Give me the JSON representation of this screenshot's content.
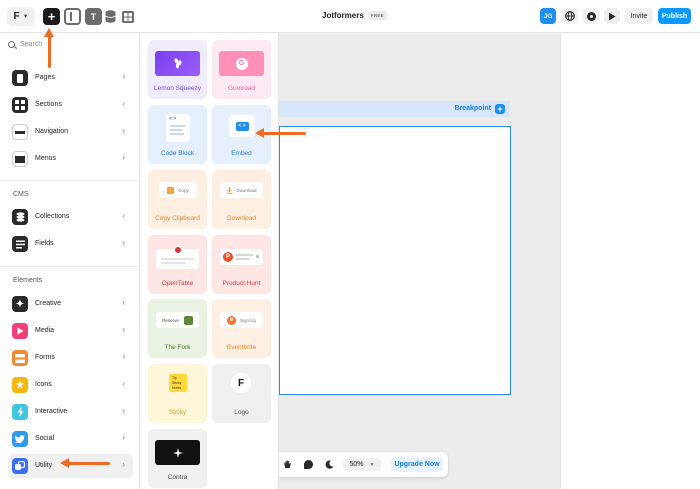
{
  "topbar": {
    "logo_glyph": "F",
    "add_glyph": "+",
    "text_tool_glyph": "T",
    "project_name": "Jotformers",
    "plan_badge": "FREE",
    "avatar_initials": "JG",
    "invite_label": "Invite",
    "publish_label": "Publish"
  },
  "sidebar": {
    "search_placeholder": "Search",
    "groups": [
      {
        "title": "",
        "items": [
          {
            "label": "Pages",
            "icon": "pages-icon"
          },
          {
            "label": "Sections",
            "icon": "sections-icon"
          },
          {
            "label": "Navigation",
            "icon": "navigation-icon"
          },
          {
            "label": "Menus",
            "icon": "menus-icon"
          }
        ]
      },
      {
        "title": "CMS",
        "items": [
          {
            "label": "Collections",
            "icon": "collections-icon"
          },
          {
            "label": "Fields",
            "icon": "fields-icon"
          }
        ]
      },
      {
        "title": "Elements",
        "items": [
          {
            "label": "Creative",
            "icon": "creative-icon"
          },
          {
            "label": "Media",
            "icon": "media-icon"
          },
          {
            "label": "Forms",
            "icon": "forms-icon"
          },
          {
            "label": "Icons",
            "icon": "icons-icon"
          },
          {
            "label": "Interactive",
            "icon": "interactive-icon"
          },
          {
            "label": "Social",
            "icon": "social-icon"
          },
          {
            "label": "Utility",
            "icon": "utility-icon",
            "active": true
          }
        ]
      }
    ]
  },
  "panel": {
    "cards": [
      {
        "label": "Lemon Squeezy"
      },
      {
        "label": "Gumroad",
        "glyph": "G"
      },
      {
        "label": "Code Block",
        "glyph": "< >"
      },
      {
        "label": "Embed",
        "glyph": "< >"
      },
      {
        "label": "Copy Clipboard",
        "button_text": "Copy"
      },
      {
        "label": "Download",
        "button_text": "Download"
      },
      {
        "label": "OpenTable"
      },
      {
        "label": "Product Hunt",
        "glyph": "P"
      },
      {
        "label": "The Fork",
        "button_text": "Reserve"
      },
      {
        "label": "Eventbrite",
        "button_text": "Sign Up",
        "glyph": "e"
      },
      {
        "label": "Sticky",
        "lines": [
          "Tip",
          "Sticky",
          "Notes"
        ]
      },
      {
        "label": "Logo",
        "glyph": "F"
      },
      {
        "label": "Contra"
      }
    ]
  },
  "canvas": {
    "breakpoint_label": "Breakpoint",
    "breakpoint_add_glyph": "+",
    "zoom_value": "50%",
    "upgrade_label": "Upgrade Now"
  },
  "colors": {
    "accent": "#0d99ff",
    "arrow": "#ef6a24",
    "frame_border": "#2e8ef0"
  }
}
